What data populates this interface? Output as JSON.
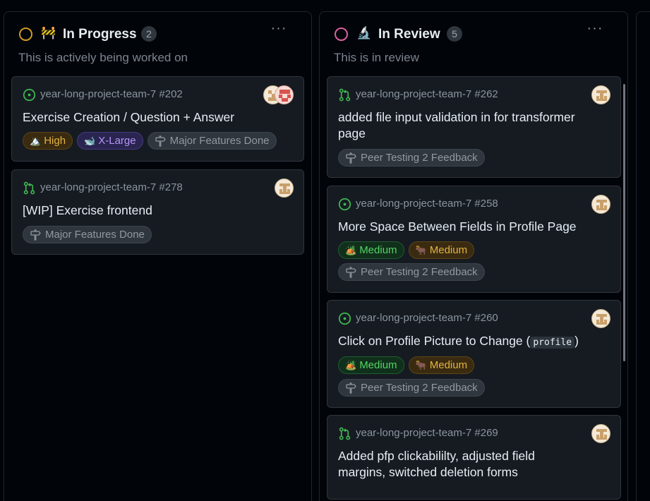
{
  "columns": [
    {
      "title": "In Progress",
      "emoji": "🚧",
      "count": "2",
      "description": "This is actively being worked on",
      "status_color": "#d29922",
      "cards": [
        {
          "ref": "year-long-project-team-7 #202",
          "kind": "issue",
          "title": "Exercise Creation / Question + Answer",
          "priority": {
            "label": "High",
            "emoji": "🏔️"
          },
          "size": {
            "label": "X-Large",
            "emoji": "🐋"
          },
          "milestone": "Major Features Done"
        },
        {
          "ref": "year-long-project-team-7 #278",
          "kind": "pull-request",
          "title": "[WIP] Exercise frontend",
          "milestone": "Major Features Done"
        }
      ]
    },
    {
      "title": "In Review",
      "emoji": "🔬",
      "count": "5",
      "description": "This is in review",
      "status_color": "#db61a2",
      "cards": [
        {
          "ref": "year-long-project-team-7 #262",
          "kind": "pull-request",
          "title": "added file input validation in for transformer page",
          "milestone": "Peer Testing 2 Feedback"
        },
        {
          "ref": "year-long-project-team-7 #258",
          "kind": "issue",
          "title": "More Space Between Fields in Profile Page",
          "priority": {
            "label": "Medium",
            "emoji": "🏕️"
          },
          "size": {
            "label": "Medium",
            "emoji": "🐂"
          },
          "milestone": "Peer Testing 2 Feedback"
        },
        {
          "ref": "year-long-project-team-7 #260",
          "kind": "issue",
          "title": "Click on Profile Picture to Change (",
          "title_code": "profile",
          "title_end": ")",
          "priority": {
            "label": "Medium",
            "emoji": "🏕️"
          },
          "size": {
            "label": "Medium",
            "emoji": "🐂"
          },
          "milestone": "Peer Testing 2 Feedback"
        },
        {
          "ref": "year-long-project-team-7 #269",
          "kind": "pull-request",
          "title": "Added pfp clickabililty, adjusted field margins, switched deletion forms"
        }
      ]
    }
  ],
  "column_menu_label": "···",
  "colors": {
    "issue_open": "#3fb950",
    "pr_open": "#3fb950",
    "background": "#010409",
    "card": "#161b22"
  },
  "icons": {
    "issue": "issue-opened-icon",
    "pull_request": "git-pull-request-icon",
    "milestone": "milestone-icon",
    "menu": "kebab-horizontal-icon"
  }
}
